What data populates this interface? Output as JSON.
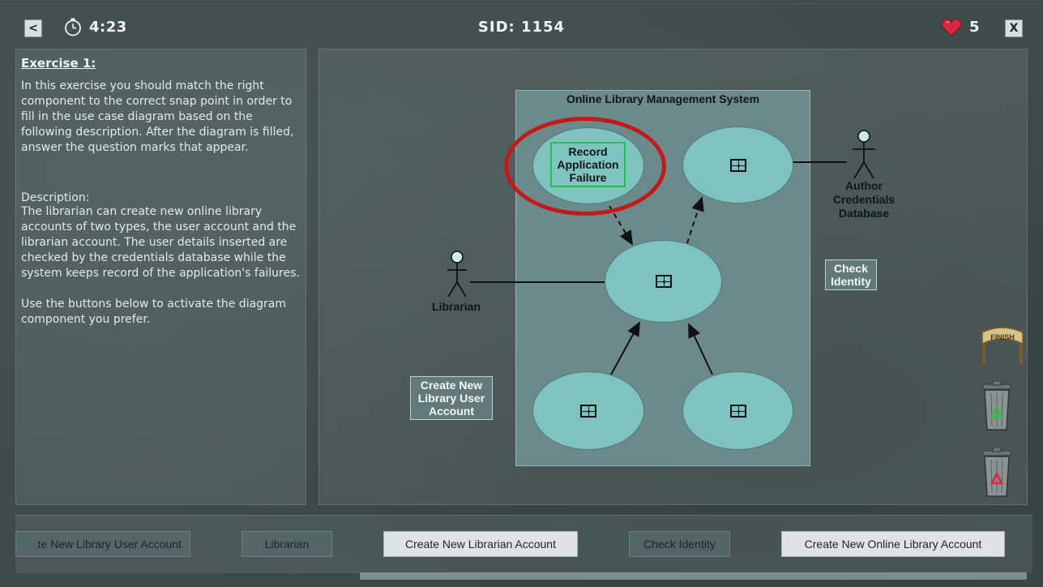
{
  "top_bar": {
    "back_label": "<",
    "timer": "4:23",
    "sid": "SID: 1154",
    "lives": "5",
    "close_label": "X"
  },
  "exercise": {
    "title": "Exercise 1:",
    "intro": "In this exercise you should match the right component to the correct snap point in order to fill in the use case diagram based on the following description. After the diagram is filled, answer the question marks that appear.",
    "description_heading": "Description:",
    "description": "The librarian can create new online library accounts of two types, the user account and the librarian account. The user details inserted are checked by the credentials database while the system keeps record of the application's failures.",
    "instruction": "Use the buttons below to activate the diagram component you prefer."
  },
  "diagram": {
    "system_title": "Online Library Management System",
    "placed_usecase": "Record\nApplication\nFailure",
    "actor_left": "Librarian",
    "actor_right": "Author\nCredentials\nDatabase",
    "floating_labels": [
      "Check\nIdentity",
      "Create New\nLibrary User\nAccount"
    ]
  },
  "tools": {
    "finish_label": "FINISH"
  },
  "components": [
    {
      "label": "te New Library User Account",
      "state": "inactive"
    },
    {
      "label": "Librarian",
      "state": "inactive"
    },
    {
      "label": "Create New Librarian Account",
      "state": "active"
    },
    {
      "label": "Check Identity",
      "state": "inactive"
    },
    {
      "label": "Create New Online Library Account",
      "state": "active"
    }
  ],
  "colors": {
    "usecase_fill": "#7fc3c0",
    "system_fill": "#6c8a8b",
    "highlight_ring": "#c41919",
    "placed_border": "#22c04a"
  }
}
